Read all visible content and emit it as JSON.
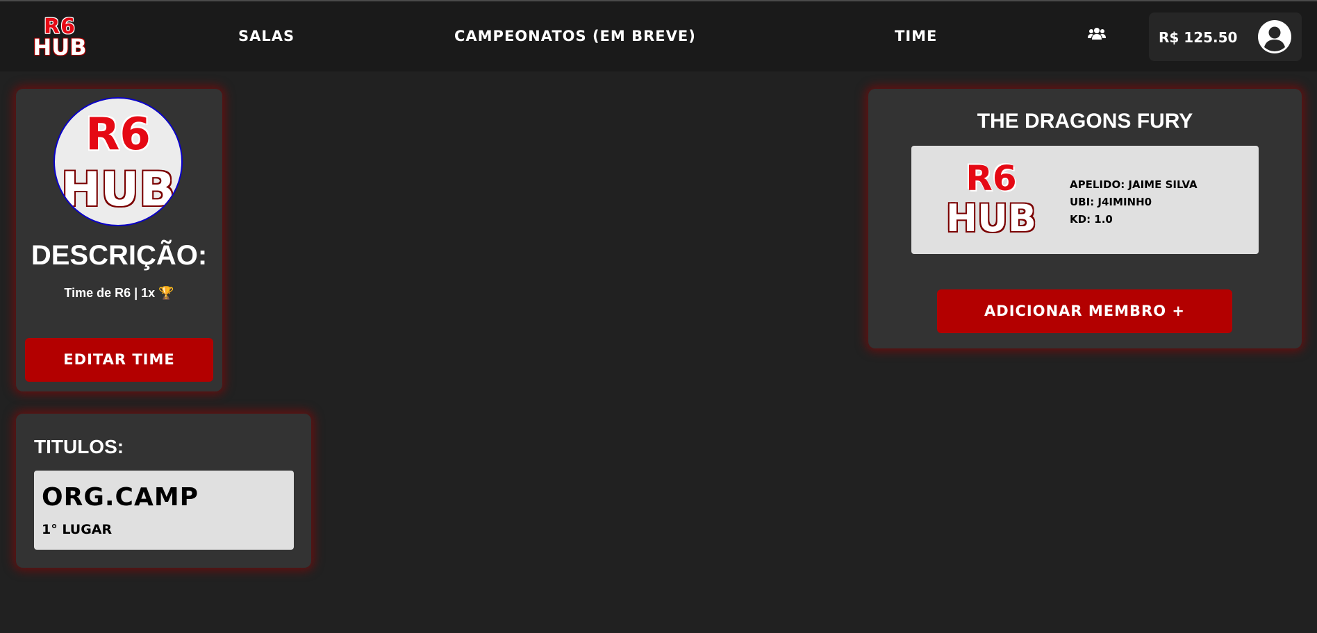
{
  "header": {
    "logo_line1": "R6",
    "logo_line2": "HUB",
    "nav": {
      "salas": "SALAS",
      "campeonatos": "CAMPEONATOS (EM BREVE)",
      "time": "TIME"
    },
    "friends_icon": "users-icon",
    "balance": "R$ 125.50",
    "avatar_icon": "user-circle-icon"
  },
  "profile": {
    "logo_line1": "R6",
    "logo_line2": "HUB",
    "description_title": "DESCRIÇÃO:",
    "description_text": "Time de R6 | 1x 🏆",
    "edit_button": "EDITAR TIME"
  },
  "titles": {
    "heading": "TITULOS:",
    "items": [
      {
        "name": "ORG.CAMP",
        "place": "1° LUGAR"
      }
    ]
  },
  "team": {
    "name": "THE DRAGONS FURY",
    "members": [
      {
        "logo_line1": "R6",
        "logo_line2": "HUB",
        "apelido": "APELIDO: JAIME SILVA",
        "ubi": "UBI: J4IMINH0",
        "kd": "KD: 1.0"
      }
    ],
    "add_button": "ADICIONAR MEMBRO +"
  },
  "colors": {
    "background": "#212121",
    "topbar": "#1a1a1a",
    "card": "#333333",
    "accent_red": "#b30000",
    "logo_red": "#e50914"
  }
}
